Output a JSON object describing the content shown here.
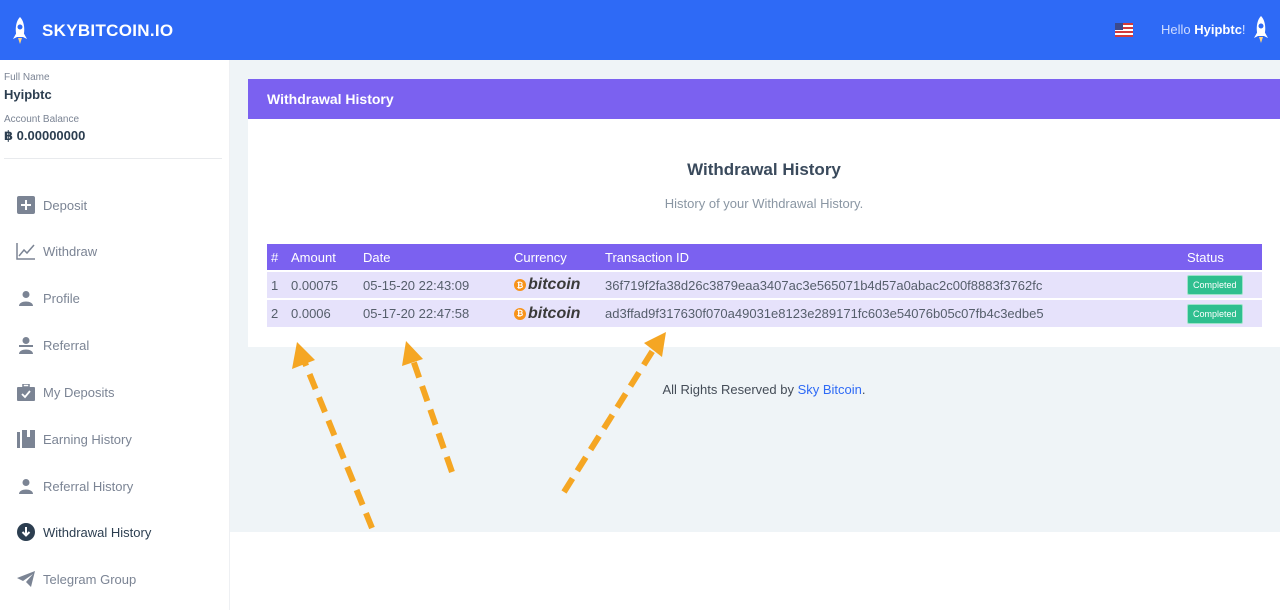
{
  "header": {
    "brand": "SKYBITCOIN.IO",
    "greeting": "Hello",
    "username": "Hyipbtc",
    "greeting_suffix": "!"
  },
  "sidebar": {
    "full_name_label": "Full Name",
    "full_name": "Hyipbtc",
    "balance_label": "Account Balance",
    "balance": "฿ 0.00000000",
    "items": [
      {
        "label": "Deposit",
        "icon": "plus-square-icon"
      },
      {
        "label": "Withdraw",
        "icon": "line-chart-icon"
      },
      {
        "label": "Profile",
        "icon": "user-icon"
      },
      {
        "label": "Referral",
        "icon": "user-tie-icon"
      },
      {
        "label": "My Deposits",
        "icon": "briefcase-check-icon"
      },
      {
        "label": "Earning History",
        "icon": "book-icon"
      },
      {
        "label": "Referral History",
        "icon": "user-icon"
      },
      {
        "label": "Withdrawal History",
        "icon": "arrow-down-circle-icon",
        "active": true
      },
      {
        "label": "Telegram Group",
        "icon": "telegram-icon"
      }
    ]
  },
  "main": {
    "card_header": "Withdrawal History",
    "title": "Withdrawal History",
    "subtitle": "History of your Withdrawal History.",
    "table": {
      "columns": [
        "#",
        "Amount",
        "Date",
        "Currency",
        "Transaction ID",
        "Status"
      ],
      "rows": [
        {
          "num": "1",
          "amount": "0.00075",
          "date": "05-15-20 22:43:09",
          "currency": "bitcoin",
          "txid": "36f719f2fa38d26c3879eaa3407ac3e565071b4d57a0abac2c00f8883f3762fc",
          "status": "Completed"
        },
        {
          "num": "2",
          "amount": "0.0006",
          "date": "05-17-20 22:47:58",
          "currency": "bitcoin",
          "txid": "ad3ffad9f317630f070a49031e8123e289171fc603e54076b05c07fb4c3edbe5",
          "status": "Completed"
        }
      ]
    }
  },
  "footer": {
    "prefix": "All Rights Reserved by",
    "link": "Sky Bitcoin",
    "suffix": "."
  },
  "colors": {
    "topbar": "#2e6af6",
    "purple": "#7b61f0",
    "row_bg": "#e6e2fb",
    "badge": "#2fbf8f",
    "arrow": "#f5a623"
  }
}
